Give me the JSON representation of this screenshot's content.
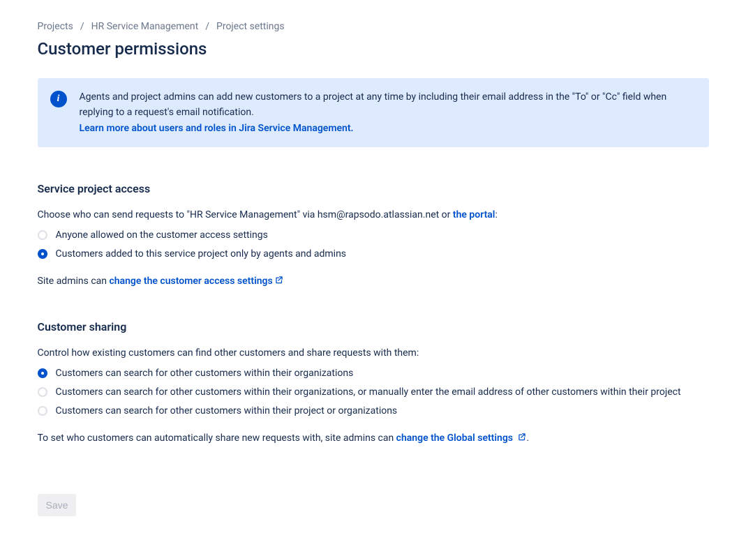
{
  "breadcrumb": {
    "item1": "Projects",
    "item2": "HR Service Management",
    "item3": "Project settings"
  },
  "page": {
    "title": "Customer permissions"
  },
  "infoPanel": {
    "text": "Agents and project admins can add new customers to a project at any time by including their email address in the \"To\" or \"Cc\" field when replying to a request's email notification.",
    "linkText": "Learn more about users and roles in Jira Service Management."
  },
  "section1": {
    "title": "Service project access",
    "desc_part1": "Choose who can send requests to \"HR Service Management\" via hsm@rapsodo.atlassian.net or ",
    "desc_link": "the portal",
    "desc_part2": ":",
    "option1": "Anyone allowed on the customer access settings",
    "option2": "Customers added to this service project only by agents and admins",
    "footnote_part1": "Site admins can ",
    "footnote_link": "change the customer access settings"
  },
  "section2": {
    "title": "Customer sharing",
    "desc": "Control how existing customers can find other customers and share requests with them:",
    "option1": "Customers can search for other customers within their organizations",
    "option2": "Customers can search for other customers within their organizations, or manually enter the email address of other customers within their project",
    "option3": "Customers can search for other customers within their project or organizations",
    "footnote_part1": "To set who customers can automatically share new requests with, site admins can ",
    "footnote_link": "change the Global settings",
    "footnote_part2": "."
  },
  "buttons": {
    "save": "Save"
  }
}
